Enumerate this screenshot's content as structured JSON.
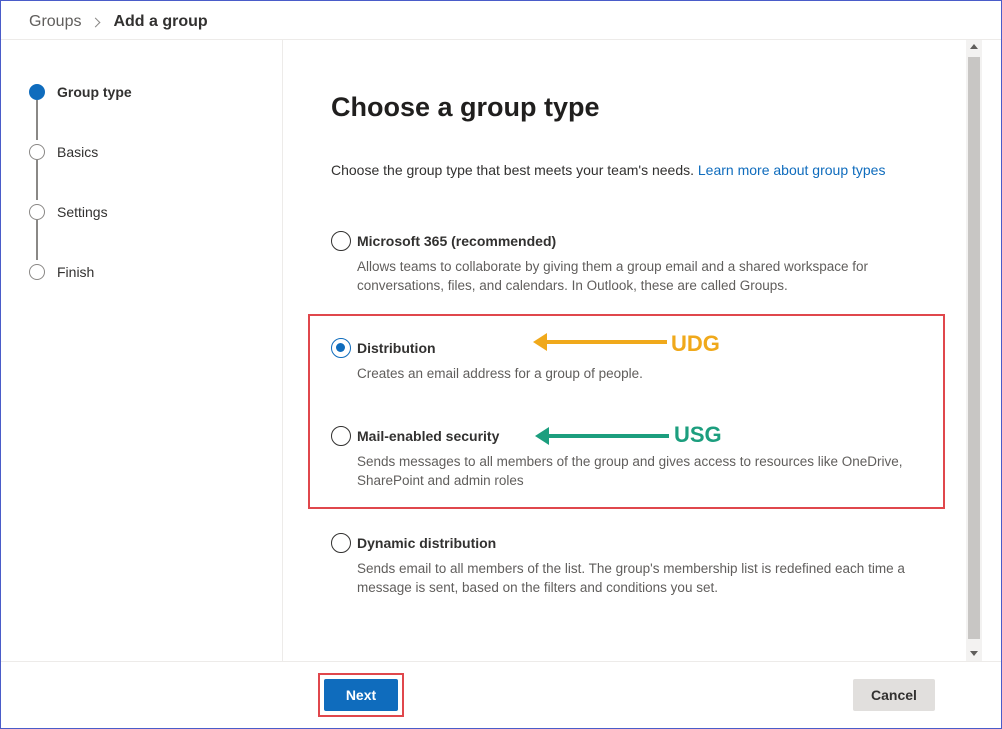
{
  "breadcrumb": {
    "parent": "Groups",
    "current": "Add a group"
  },
  "steps": [
    {
      "label": "Group type",
      "state": "active"
    },
    {
      "label": "Basics",
      "state": "pending"
    },
    {
      "label": "Settings",
      "state": "pending"
    },
    {
      "label": "Finish",
      "state": "pending"
    }
  ],
  "main": {
    "title": "Choose a group type",
    "intro": "Choose the group type that best meets your team's needs.",
    "learn_more": "Learn more about group types",
    "options": [
      {
        "label": "Microsoft 365 (recommended)",
        "description": "Allows teams to collaborate by giving them a group email and a shared workspace for conversations, files, and calendars. In Outlook, these are called Groups.",
        "selected": false
      },
      {
        "label": "Distribution",
        "description": "Creates an email address for a group of people.",
        "selected": true
      },
      {
        "label": "Mail-enabled security",
        "description": "Sends messages to all members of the group and gives access to resources like OneDrive, SharePoint and admin roles",
        "selected": false
      },
      {
        "label": "Dynamic distribution",
        "description": "Sends email to all members of the list. The group's membership list is redefined each time a message is sent, based on the filters and conditions you set.",
        "selected": false
      }
    ]
  },
  "annotations": {
    "udg": {
      "text": "UDG",
      "color": "#f0a91b"
    },
    "usg": {
      "text": "USG",
      "color": "#1c9e7e"
    },
    "highlight_color": "#e0474c"
  },
  "footer": {
    "next_label": "Next",
    "cancel_label": "Cancel"
  },
  "colors": {
    "accent": "#0f6cbd"
  }
}
